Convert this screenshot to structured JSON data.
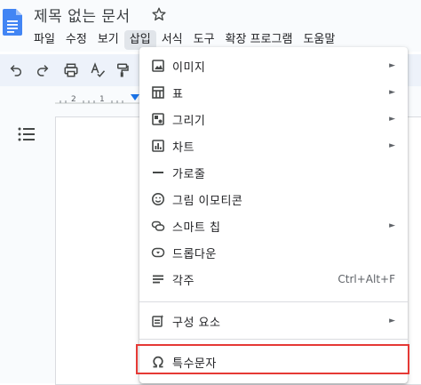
{
  "document": {
    "title": "제목 없는 문서"
  },
  "menubar": {
    "items": [
      "파일",
      "수정",
      "보기",
      "삽입",
      "서식",
      "도구",
      "확장 프로그램",
      "도움말"
    ],
    "active": "삽입"
  },
  "ruler": {
    "labels": [
      "2",
      "1"
    ]
  },
  "insert_menu": {
    "items": [
      {
        "label": "이미지",
        "icon": "image-icon",
        "submenu": true
      },
      {
        "label": "표",
        "icon": "table-icon",
        "submenu": true
      },
      {
        "label": "그리기",
        "icon": "drawing-icon",
        "submenu": true
      },
      {
        "label": "차트",
        "icon": "chart-icon",
        "submenu": true
      },
      {
        "label": "가로줄",
        "icon": "horizontal-line-icon",
        "submenu": false
      },
      {
        "label": "그림 이모티콘",
        "icon": "emoji-icon",
        "submenu": false
      },
      {
        "label": "스마트 칩",
        "icon": "smart-chip-icon",
        "submenu": true
      },
      {
        "label": "드롭다운",
        "icon": "dropdown-icon",
        "submenu": false
      },
      {
        "label": "각주",
        "icon": "footnote-icon",
        "submenu": false,
        "shortcut": "Ctrl+Alt+F"
      },
      {
        "label": "구성 요소",
        "icon": "building-blocks-icon",
        "submenu": true
      },
      {
        "label": "특수문자",
        "icon": "omega-icon",
        "submenu": false
      }
    ],
    "arrow_glyph": "►"
  },
  "colors": {
    "doc_blue": "#4285f4",
    "highlight_red": "#e53935",
    "ruler_blue": "#1a73e8"
  }
}
